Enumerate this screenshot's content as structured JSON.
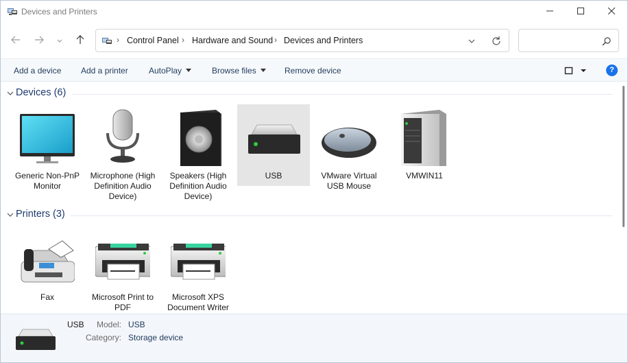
{
  "window": {
    "title": "Devices and Printers",
    "controls": {
      "minimize_icon": "minimize-icon",
      "maximize_icon": "maximize-icon",
      "close_icon": "close-icon"
    }
  },
  "address": {
    "breadcrumbs": [
      "Control Panel",
      "Hardware and Sound",
      "Devices and Printers"
    ],
    "search_placeholder": ""
  },
  "toolbar": {
    "add_device": "Add a device",
    "add_printer": "Add a printer",
    "autoplay": "AutoPlay",
    "browse_files": "Browse files",
    "remove_device": "Remove device",
    "help": "?"
  },
  "devices_group": {
    "title": "Devices (6)",
    "items": [
      {
        "label": "Generic Non-PnP Monitor",
        "icon": "monitor-icon"
      },
      {
        "label": "Microphone (High Definition Audio Device)",
        "icon": "microphone-icon"
      },
      {
        "label": "Speakers (High Definition Audio Device)",
        "icon": "speaker-icon"
      },
      {
        "label": "USB",
        "icon": "drive-icon",
        "selected": true
      },
      {
        "label": "VMware Virtual USB Mouse",
        "icon": "mouse-icon"
      },
      {
        "label": "VMWIN11",
        "icon": "computer-icon"
      }
    ]
  },
  "printers_group": {
    "title": "Printers (3)",
    "items": [
      {
        "label": "Fax",
        "icon": "fax-icon"
      },
      {
        "label": "Microsoft Print to PDF",
        "icon": "printer-icon"
      },
      {
        "label": "Microsoft XPS Document Writer",
        "icon": "printer-icon"
      }
    ]
  },
  "details": {
    "name": "USB",
    "model_key": "Model:",
    "model_value": "USB",
    "category_key": "Category:",
    "category_value": "Storage device"
  },
  "colors": {
    "accent": "#1a73e8",
    "group_title": "#1e3a6e",
    "selection": "#e5e5e5",
    "details_bg": "#f3f6fb"
  }
}
